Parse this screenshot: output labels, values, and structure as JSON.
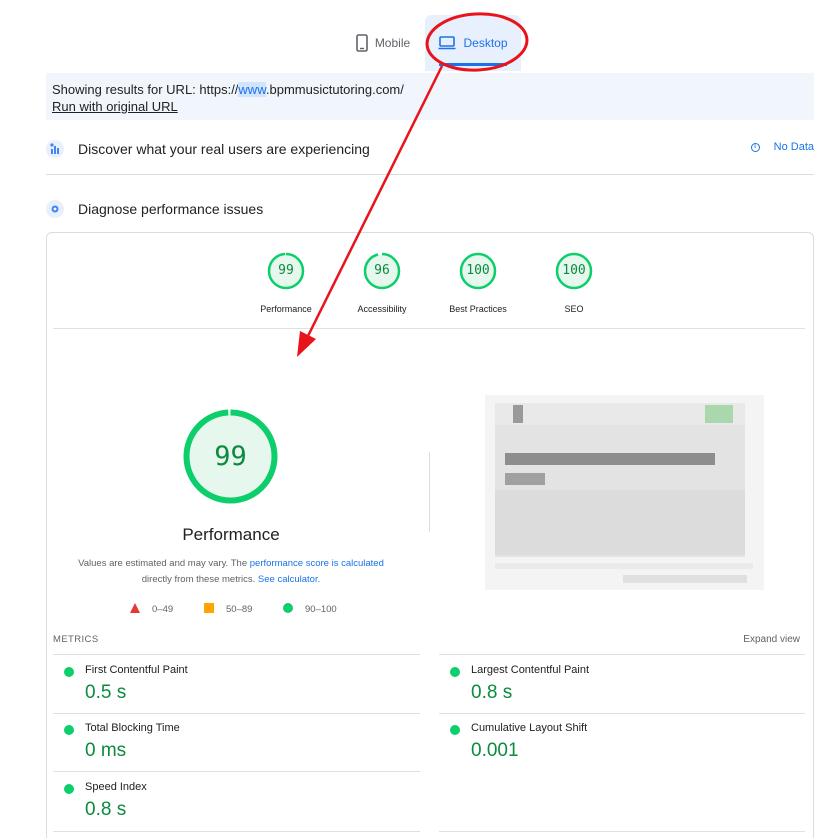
{
  "tabs": {
    "mobile_label": "Mobile",
    "desktop_label": "Desktop",
    "active": "Desktop"
  },
  "url_bar": {
    "prefix": "Showing results for URL: https://",
    "highlight": "www",
    "suffix": ".bpmmusictutoring.com/",
    "run_original_label": "Run with original URL"
  },
  "real_users": {
    "title": "Discover what your real users are experiencing",
    "status_label": "No Data"
  },
  "diagnose": {
    "title": "Diagnose performance issues"
  },
  "category_scores": [
    {
      "label": "Performance",
      "score": "99"
    },
    {
      "label": "Accessibility",
      "score": "96"
    },
    {
      "label": "Best Practices",
      "score": "100"
    },
    {
      "label": "SEO",
      "score": "100"
    }
  ],
  "performance": {
    "score": "99",
    "title": "Performance",
    "desc_part1": "Values are estimated and may vary. The ",
    "desc_link1": "performance score is calculated",
    "desc_part2": "directly from these metrics. ",
    "desc_link2": "See calculator."
  },
  "legend": [
    {
      "shape": "triangle",
      "range": "0–49",
      "color": "#e53935"
    },
    {
      "shape": "square",
      "range": "50–89",
      "color": "#ffa400"
    },
    {
      "shape": "circle",
      "range": "90–100",
      "color": "#0cce6b"
    }
  ],
  "metrics": {
    "header": "METRICS",
    "expand_label": "Expand view",
    "items": [
      {
        "name": "First Contentful Paint",
        "value": "0.5 s"
      },
      {
        "name": "Largest Contentful Paint",
        "value": "0.8 s"
      },
      {
        "name": "Total Blocking Time",
        "value": "0 ms"
      },
      {
        "name": "Cumulative Layout Shift",
        "value": "0.001"
      },
      {
        "name": "Speed Index",
        "value": "0.8 s"
      }
    ]
  },
  "colors": {
    "pass_green": "#0cce6b",
    "pass_text": "#0c8a3e",
    "accent_blue": "#1a73e8",
    "annotation_red": "#e8141b"
  }
}
